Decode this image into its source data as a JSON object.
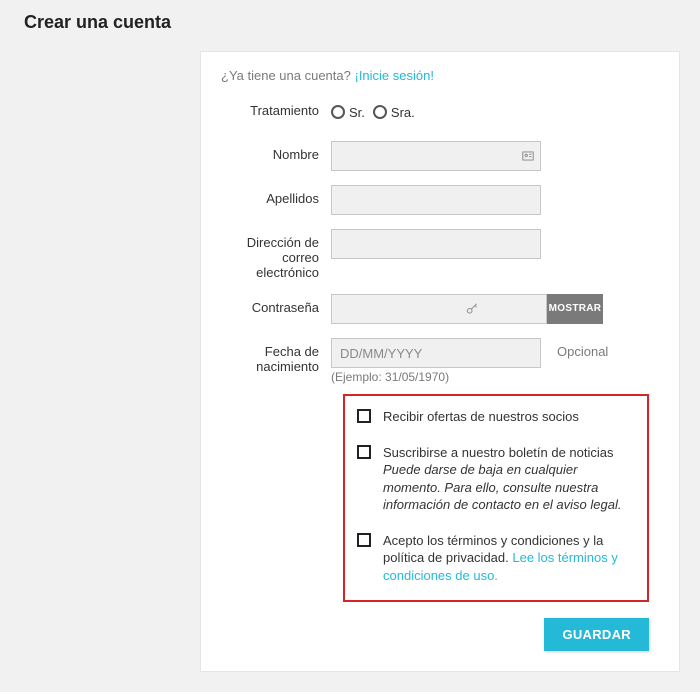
{
  "page_title": "Crear una cuenta",
  "login_prompt": {
    "question": "¿Ya tiene una cuenta?",
    "link": "¡Inicie sesión!"
  },
  "fields": {
    "tratamiento": {
      "label": "Tratamiento",
      "options": {
        "sr": "Sr.",
        "sra": "Sra."
      }
    },
    "nombre": {
      "label": "Nombre"
    },
    "apellidos": {
      "label": "Apellidos"
    },
    "email": {
      "label": "Dirección de correo electrónico"
    },
    "password": {
      "label": "Contraseña",
      "show_btn": "MOSTRAR"
    },
    "birthdate": {
      "label": "Fecha de nacimiento",
      "placeholder": "DD/MM/YYYY",
      "hint": "(Ejemplo: 31/05/1970)",
      "optional": "Opcional"
    }
  },
  "checkboxes": {
    "offers": "Recibir ofertas de nuestros socios",
    "newsletter": {
      "label": "Suscribirse a nuestro boletín de noticias",
      "note": "Puede darse de baja en cualquier momento. Para ello, consulte nuestra información de contacto en el aviso legal."
    },
    "terms": {
      "label": "Acepto los términos y condiciones y la política de privacidad. ",
      "link": "Lee los términos y condiciones de uso."
    }
  },
  "submit": "GUARDAR"
}
